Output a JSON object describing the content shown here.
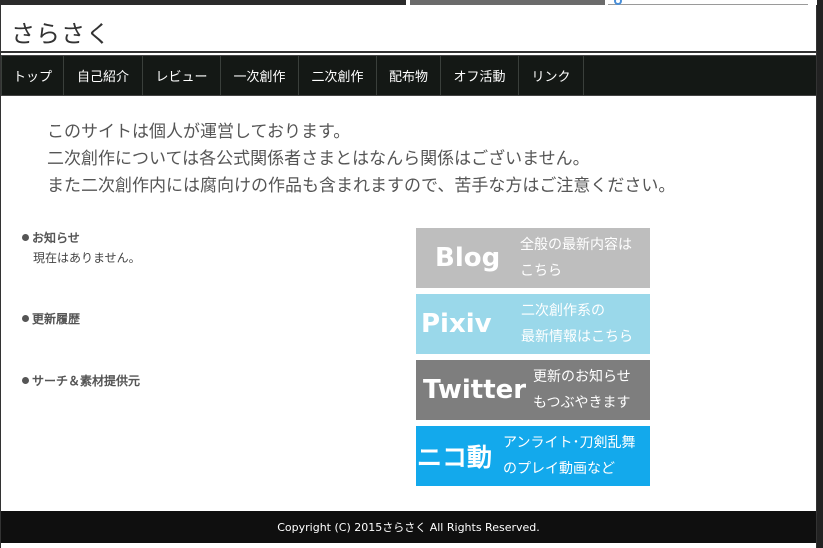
{
  "site": {
    "title": "さらさく"
  },
  "nav": {
    "items": [
      {
        "label": "トップ"
      },
      {
        "label": "自己紹介"
      },
      {
        "label": "レビュー"
      },
      {
        "label": "一次創作"
      },
      {
        "label": "二次創作"
      },
      {
        "label": "配布物"
      },
      {
        "label": "オフ活動"
      },
      {
        "label": "リンク"
      }
    ]
  },
  "intro": {
    "lines": [
      "このサイトは個人が運営しております。",
      "二次創作については各公式関係者さまとはなんら関係はございません。",
      "また二次創作内には腐向けの作品も含まれますので、苦手な方はご注意ください。"
    ]
  },
  "sections": {
    "news": {
      "heading": "お知らせ",
      "body": "現在はありません。"
    },
    "history": {
      "heading": "更新履歴"
    },
    "credits": {
      "heading": "サーチ＆素材提供元"
    }
  },
  "banners": {
    "blog": {
      "title": "Blog",
      "line1": "全般の最新内容は",
      "line2": "こちら",
      "color": "#bebebe"
    },
    "pixiv": {
      "title": "Pixiv",
      "line1": "二次創作系の",
      "line2": "最新情報はこちら",
      "color": "#9ad8ea"
    },
    "twitter": {
      "title": "Twitter",
      "line1": "更新のお知らせ",
      "line2": "もつぶやきます",
      "color": "#7e7e7e"
    },
    "nico": {
      "title": "ニコ動",
      "line1": "アンライト･刀剣乱舞",
      "line2": "のプレイ動画など",
      "color": "#13a9ec"
    }
  },
  "footer": {
    "copyright": "Copyright (C) 2015さらさく All Rights Reserved."
  },
  "theme": {
    "nav_bg": "#141815",
    "footer_bg": "#0f0f0f"
  }
}
